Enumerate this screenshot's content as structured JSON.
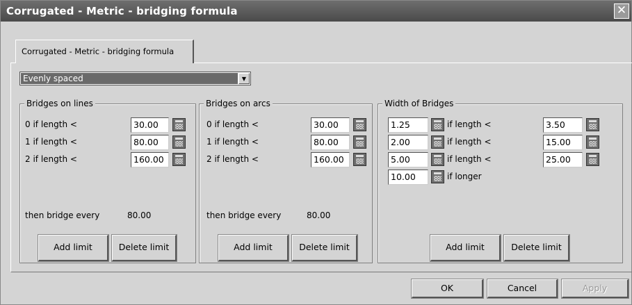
{
  "window": {
    "title": "Corrugated - Metric - bridging formula",
    "close_glyph": "✕"
  },
  "tab": {
    "label": "Corrugated - Metric - bridging formula"
  },
  "dropdown": {
    "value": "Evenly spaced",
    "arrow_glyph": "▼"
  },
  "lines": {
    "title": "Bridges on lines",
    "rows": [
      {
        "label": "0  if length <",
        "value": "30.00"
      },
      {
        "label": "1  if length <",
        "value": "80.00"
      },
      {
        "label": "2  if length <",
        "value": "160.00"
      }
    ],
    "then_label": "then bridge every",
    "then_value": "80.00",
    "add_label": "Add limit",
    "delete_label": "Delete limit"
  },
  "arcs": {
    "title": "Bridges on arcs",
    "rows": [
      {
        "label": "0  if length <",
        "value": "30.00"
      },
      {
        "label": "1  if length <",
        "value": "80.00"
      },
      {
        "label": "2  if length <",
        "value": "160.00"
      }
    ],
    "then_label": "then bridge every",
    "then_value": "80.00",
    "add_label": "Add limit",
    "delete_label": "Delete limit"
  },
  "width": {
    "title": "Width of Bridges",
    "rows": [
      {
        "width": "1.25",
        "label": "if length <",
        "limit": "3.50"
      },
      {
        "width": "2.00",
        "label": "if length <",
        "limit": "15.00"
      },
      {
        "width": "5.00",
        "label": "if length <",
        "limit": "25.00"
      }
    ],
    "longer_width": "10.00",
    "longer_label": "if longer",
    "add_label": "Add limit",
    "delete_label": "Delete limit"
  },
  "footer": {
    "ok_label": "OK",
    "cancel_label": "Cancel",
    "apply_label": "Apply"
  }
}
